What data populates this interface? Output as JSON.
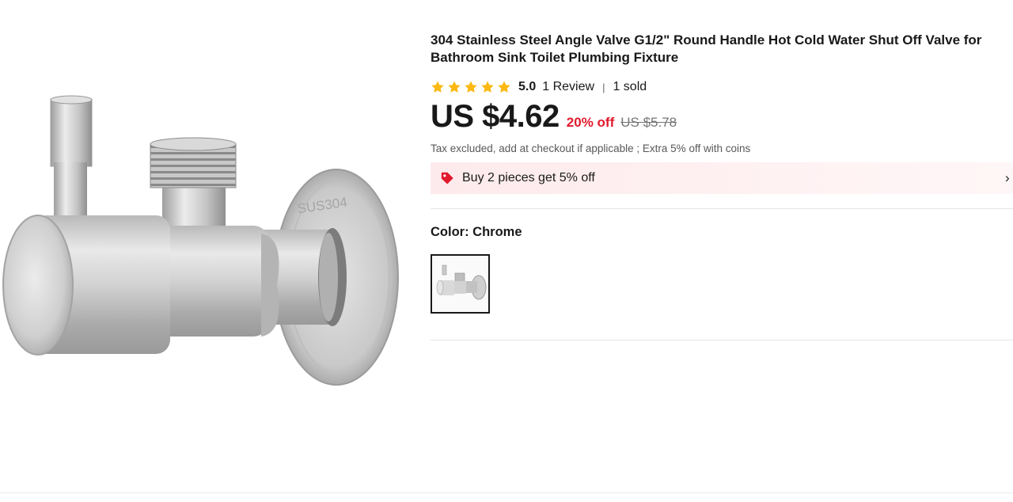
{
  "product": {
    "title": "304 Stainless Steel Angle Valve G1/2\" Round Handle Hot Cold Water Shut Off Valve for Bathroom Sink Toilet Plumbing Fixture",
    "image_text": "SUS304",
    "rating": {
      "stars": 5,
      "value": "5.0",
      "reviews": "1 Review",
      "separator": "|",
      "sold": "1 sold"
    },
    "price": {
      "current": "US $4.62",
      "discount": "20% off",
      "original": "US $5.78"
    },
    "tax_note": "Tax excluded, add at checkout if applicable ; Extra 5% off with coins",
    "promo": {
      "text": "Buy 2 pieces get 5% off",
      "icon": "price-tag-icon",
      "chevron": "›"
    },
    "color": {
      "label": "Color: Chrome",
      "selected_index": 0,
      "options": [
        "Chrome"
      ]
    }
  },
  "colors": {
    "accent_red": "#e2192c",
    "star_yellow": "#fdb913",
    "text": "#191919",
    "promo_bg": "#fdeaec"
  }
}
